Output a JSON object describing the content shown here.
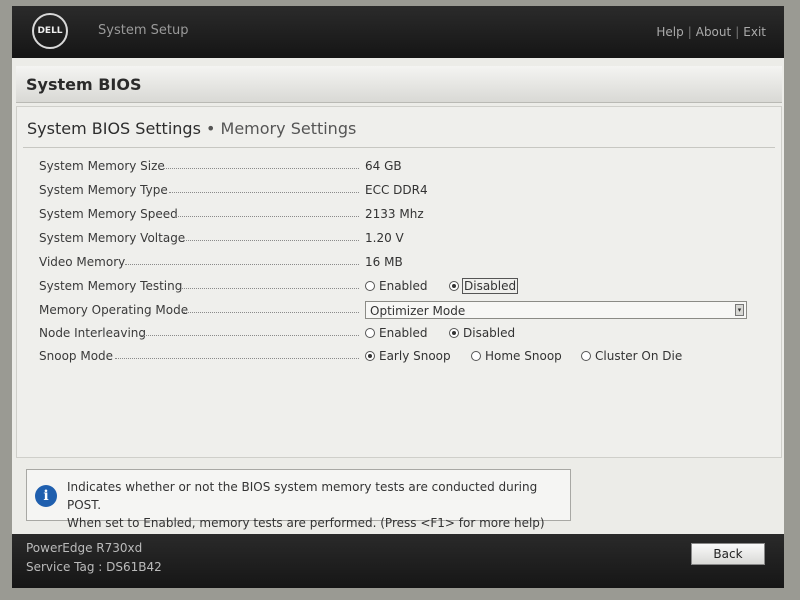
{
  "header": {
    "logo_text": "DELL",
    "app_title": "System Setup",
    "links": [
      "Help",
      "About",
      "Exit"
    ]
  },
  "section_title": "System BIOS",
  "breadcrumb": {
    "main": "System BIOS Settings",
    "separator": "•",
    "sub": "Memory Settings"
  },
  "settings": {
    "memory_size": {
      "label": "System Memory Size",
      "value": "64 GB"
    },
    "memory_type": {
      "label": "System Memory Type",
      "value": "ECC DDR4"
    },
    "memory_speed": {
      "label": "System Memory Speed",
      "value": "2133 Mhz"
    },
    "memory_voltage": {
      "label": "System Memory Voltage",
      "value": "1.20 V"
    },
    "video_memory": {
      "label": "Video Memory",
      "value": "16 MB"
    },
    "memory_testing": {
      "label": "System Memory Testing",
      "options": [
        "Enabled",
        "Disabled"
      ],
      "selected": "Disabled"
    },
    "operating_mode": {
      "label": "Memory Operating Mode",
      "value": "Optimizer Mode"
    },
    "node_interleaving": {
      "label": "Node Interleaving",
      "options": [
        "Enabled",
        "Disabled"
      ],
      "selected": "Disabled"
    },
    "snoop_mode": {
      "label": "Snoop Mode",
      "options": [
        "Early Snoop",
        "Home Snoop",
        "Cluster On Die"
      ],
      "selected": "Early Snoop"
    }
  },
  "help": {
    "icon": "info-icon",
    "line1": "Indicates whether or not the BIOS system memory tests are conducted during POST.",
    "line2": "When set to Enabled, memory tests are performed. (Press <F1> for more help)"
  },
  "footer": {
    "model": "PowerEdge R730xd",
    "service_tag": "Service Tag : DS61B42",
    "back_label": "Back"
  }
}
